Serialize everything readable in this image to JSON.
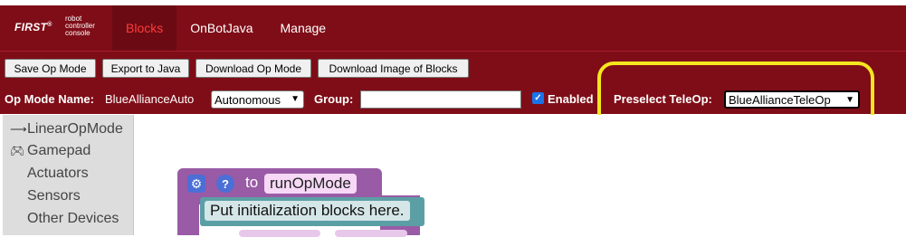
{
  "logo": {
    "brand": "FIRST",
    "mark": "®",
    "sub_lines": [
      "robot",
      "controller",
      "console"
    ]
  },
  "nav": {
    "tabs": [
      {
        "label": "Blocks",
        "active": true
      },
      {
        "label": "OnBotJava",
        "active": false
      },
      {
        "label": "Manage",
        "active": false
      }
    ]
  },
  "toolbar": {
    "save_label": "Save Op Mode",
    "export_label": "Export to Java",
    "download_label": "Download Op Mode",
    "download_image_label": "Download Image of Blocks"
  },
  "opmode": {
    "name_label": "Op Mode Name:",
    "name_value": "BlueAllianceAuto",
    "type_value": "Autonomous",
    "group_label": "Group:",
    "group_value": "",
    "enabled_label": "Enabled",
    "enabled_checked": true,
    "preselect_label": "Preselect TeleOp:",
    "preselect_value": "BlueAllianceTeleOp"
  },
  "highlight_color": "#f5e61f",
  "sidebar": {
    "items": [
      {
        "label": "LinearOpMode",
        "icon": "arrow-right-icon"
      },
      {
        "label": "Gamepad",
        "icon": "gamepad-icon"
      },
      {
        "label": "Actuators",
        "icon": ""
      },
      {
        "label": "Sensors",
        "icon": ""
      },
      {
        "label": "Other Devices",
        "icon": ""
      }
    ]
  },
  "workspace": {
    "to_label": "to",
    "function_name": "runOpMode",
    "comment": "Put initialization blocks here."
  },
  "colors": {
    "nav_bg": "#7f0d17",
    "active_tab_text": "#ff3b3b",
    "procedure_block": "#995ba5",
    "comment_block": "#5b9fa5"
  }
}
